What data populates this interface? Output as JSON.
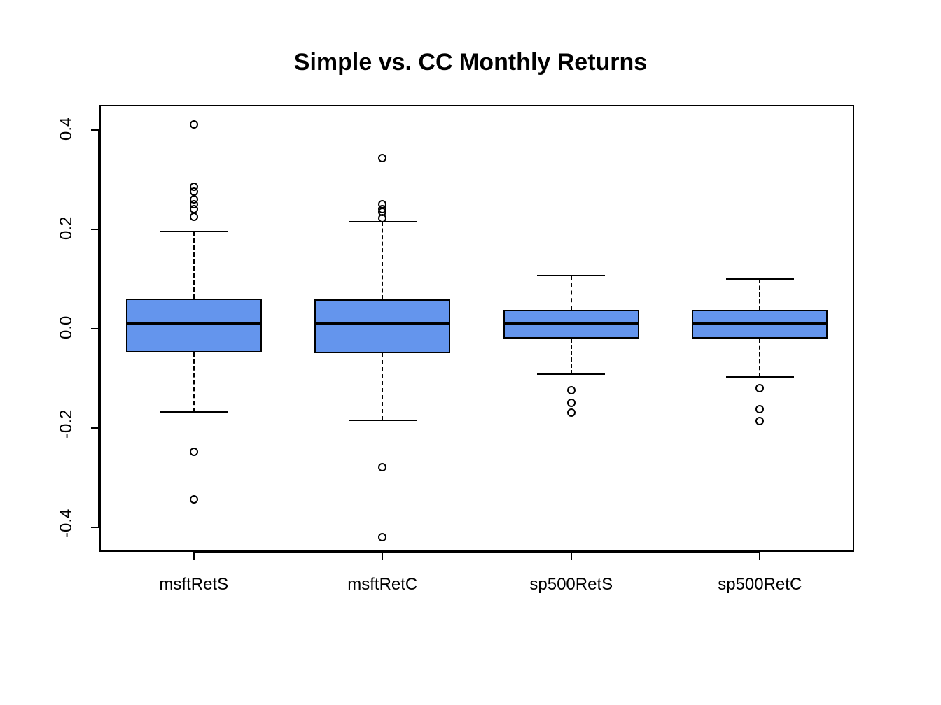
{
  "chart_data": {
    "type": "boxplot",
    "title": "Simple vs. CC Monthly Returns",
    "ylabel": "",
    "xlabel": "",
    "ylim": [
      -0.45,
      0.45
    ],
    "y_ticks": [
      -0.4,
      -0.2,
      0.0,
      0.2,
      0.4
    ],
    "categories": [
      "msftRetS",
      "msftRetC",
      "sp500RetS",
      "sp500RetC"
    ],
    "series": [
      {
        "name": "msftRetS",
        "q1": -0.048,
        "median": 0.01,
        "q3": 0.06,
        "whisker_low": -0.168,
        "whisker_high": 0.195,
        "outliers": [
          0.41,
          0.285,
          0.275,
          0.26,
          0.25,
          0.24,
          0.225,
          -0.248,
          -0.345
        ]
      },
      {
        "name": "msftRetC",
        "q1": -0.05,
        "median": 0.01,
        "q3": 0.058,
        "whisker_low": -0.185,
        "whisker_high": 0.215,
        "outliers": [
          0.343,
          0.25,
          0.24,
          0.235,
          0.222,
          -0.28,
          -0.42
        ]
      },
      {
        "name": "sp500RetS",
        "q1": -0.02,
        "median": 0.01,
        "q3": 0.038,
        "whisker_low": -0.092,
        "whisker_high": 0.106,
        "outliers": [
          -0.125,
          -0.15,
          -0.17
        ]
      },
      {
        "name": "sp500RetC",
        "q1": -0.021,
        "median": 0.01,
        "q3": 0.037,
        "whisker_low": -0.098,
        "whisker_high": 0.1,
        "outliers": [
          -0.12,
          -0.162,
          -0.187
        ]
      }
    ],
    "box_fill": "#6495ED"
  }
}
